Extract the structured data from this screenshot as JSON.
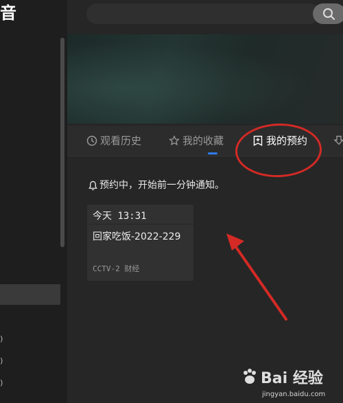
{
  "app": {
    "title_fragment": "音"
  },
  "sidebar": {
    "fragments": [
      ")",
      ")",
      ")"
    ]
  },
  "tabs": [
    {
      "label": "观看历史",
      "icon": "clock-icon"
    },
    {
      "label": "我的收藏",
      "icon": "star-icon"
    },
    {
      "label": "我的预约",
      "icon": "bookmark-plus-icon",
      "active": true
    },
    {
      "label": "",
      "icon": "download-icon"
    }
  ],
  "notice": "预约中，开始前一分钟通知。",
  "reservation": {
    "time": "今天 13:31",
    "title": "回家吃饭-2022-229",
    "channel": "CCTV-2 财经"
  },
  "watermark": {
    "main": "Bai 经验",
    "sub": "jingyan.baidu.com"
  },
  "colors": {
    "accent": "#2f7df6",
    "annotation": "#d42a25"
  }
}
